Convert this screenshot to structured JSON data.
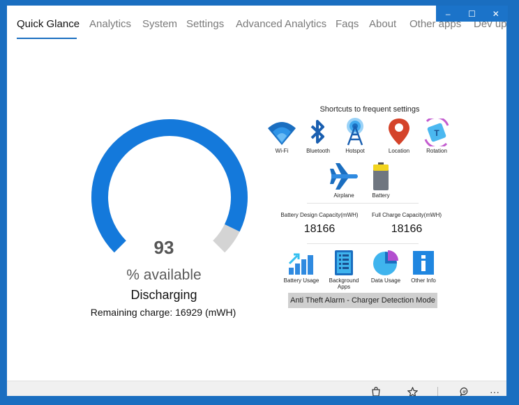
{
  "window": {
    "controls": {
      "minimize": "–",
      "maximize": "☐",
      "close": "✕"
    }
  },
  "tabs": [
    {
      "label": "Quick Glance",
      "active": true
    },
    {
      "label": "Analytics"
    },
    {
      "label": "System"
    },
    {
      "label": "Settings"
    },
    {
      "label": "Advanced Analytics"
    },
    {
      "label": "Faqs"
    },
    {
      "label": "About"
    },
    {
      "label": "Other apps"
    },
    {
      "label": "Dev up"
    }
  ],
  "battery": {
    "percent": "93",
    "percent_value": 93,
    "available_label": "% available",
    "status": "Discharging",
    "remaining": "Remaining charge: 16929 (mWH)"
  },
  "shortcuts": {
    "title": "Shortcuts to frequent settings",
    "items": [
      {
        "label": "Wi-Fi",
        "icon": "wifi-icon"
      },
      {
        "label": "Bluetooth",
        "icon": "bluetooth-icon"
      },
      {
        "label": "Hotspot",
        "icon": "hotspot-icon"
      },
      {
        "label": "Location",
        "icon": "location-icon"
      },
      {
        "label": "Rotation",
        "icon": "rotation-icon"
      },
      {
        "label": "Airplane",
        "icon": "airplane-icon"
      },
      {
        "label": "Battery",
        "icon": "battery-icon"
      }
    ]
  },
  "capacity": {
    "design_label": "Battery Design Capacity(mWH)",
    "design_value": "18166",
    "full_label": "Full Charge Capacity(mWH)",
    "full_value": "18166"
  },
  "tools": [
    {
      "label": "Battery Usage",
      "icon": "battery-usage-icon"
    },
    {
      "label": "Background Apps",
      "icon": "background-apps-icon"
    },
    {
      "label": "Data Usage",
      "icon": "data-usage-icon"
    },
    {
      "label": "Other Info",
      "icon": "info-icon"
    }
  ],
  "alarm_button": "Anti Theft Alarm - Charger Detection Mode",
  "bottom_bar": {
    "icons": [
      "bag-icon",
      "star-icon",
      "feedback-icon",
      "more-icon"
    ],
    "more_glyph": "···"
  },
  "colors": {
    "accent": "#1a6ec0",
    "gauge_fill": "#1479db",
    "gauge_track": "#d4d4d4"
  }
}
